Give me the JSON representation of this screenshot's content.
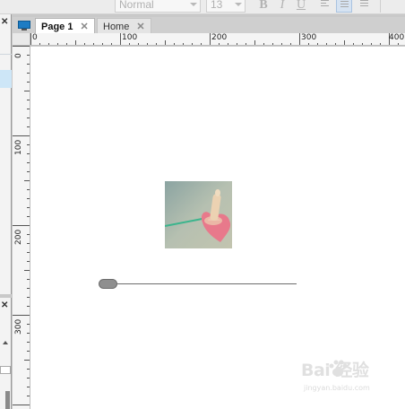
{
  "toolbar": {
    "font_style": "Normal",
    "font_size": "13",
    "bold_label": "B",
    "italic_label": "I",
    "underline_label": "U"
  },
  "left_panel": {
    "close_glyph": "✕"
  },
  "tabs": [
    {
      "label": "Page 1",
      "close": "✕",
      "active": true
    },
    {
      "label": "Home",
      "close": "✕",
      "active": false
    }
  ],
  "ruler": {
    "horizontal": [
      "0",
      "100",
      "200",
      "300",
      "400"
    ],
    "vertical": [
      "0",
      "100",
      "200",
      "300"
    ]
  },
  "canvas": {
    "image_icon": "photo-heart-icon",
    "slider_value": 0
  },
  "watermark": {
    "logo": "Bai 经验",
    "url": "jingyan.baidu.com"
  },
  "colors": {
    "accent": "#1d7cc4",
    "selection": "#cde6f7",
    "canvas": "#ffffff"
  }
}
